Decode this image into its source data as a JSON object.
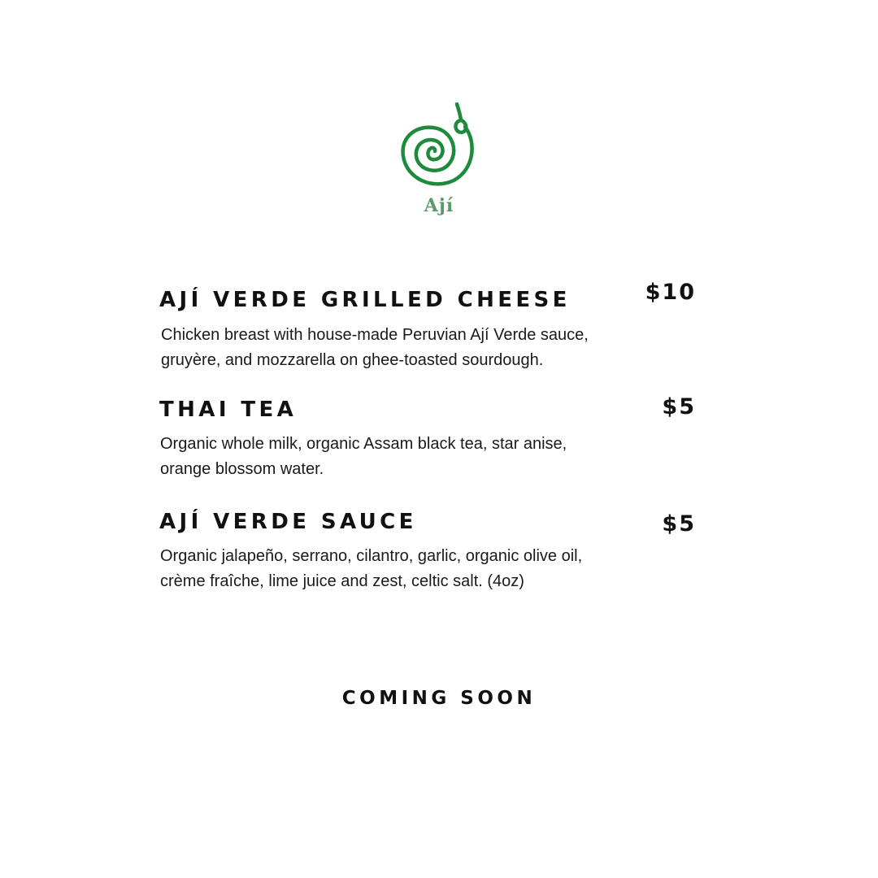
{
  "brand": {
    "name": "Ají",
    "logo_icon": "chili-spiral-icon",
    "color": "#1e8a3c"
  },
  "menu": {
    "items": [
      {
        "name": "AJÍ VERDE GRILLED CHEESE",
        "price": "$10",
        "description": "Chicken breast with house-made Peruvian Ají Verde sauce, gruyère, and mozzarella on ghee-toasted sourdough."
      },
      {
        "name": "THAI TEA",
        "price": "$5",
        "description": "Organic whole milk, organic Assam black tea, star anise, orange blossom water."
      },
      {
        "name": "AJÍ VERDE SAUCE",
        "price": "$5",
        "description": "Organic jalapeño, serrano, cilantro, garlic, organic olive oil, crème fraîche, lime juice and zest, celtic salt. (4oz)"
      }
    ]
  },
  "footer": {
    "coming_soon": "COMING SOON"
  }
}
